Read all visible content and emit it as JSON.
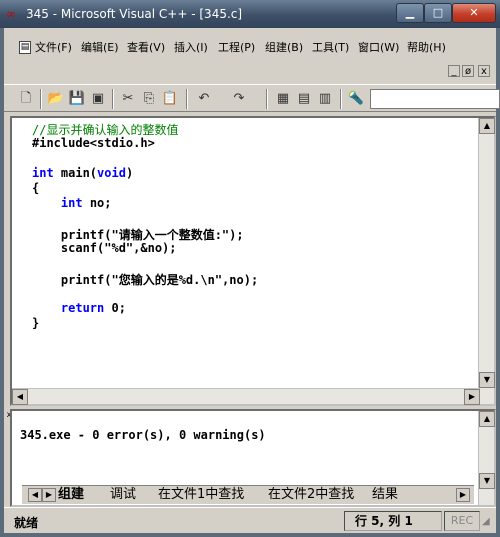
{
  "window": {
    "title": "345 - Microsoft Visual C++ - [345.c]",
    "min_glyph": "▁",
    "max_glyph": "□",
    "close_glyph": "✕"
  },
  "menu": {
    "items": [
      "文件(F)",
      "编辑(E)",
      "查看(V)",
      "插入(I)",
      "工程(P)",
      "组建(B)",
      "工具(T)",
      "窗口(W)",
      "帮助(H)"
    ],
    "mdi_min": "_",
    "mdi_restore": "ø",
    "mdi_close": "x"
  },
  "toolbar": {
    "icons": [
      "new-file-icon",
      "open-folder-icon",
      "save-icon",
      "save-all-icon",
      "cut-icon",
      "copy-icon",
      "paste-icon",
      "undo-icon",
      "redo-icon",
      "workspace-icon",
      "output-window-icon",
      "window-list-icon",
      "find-in-files-icon"
    ],
    "glyphs": [
      "🗋",
      "📂",
      "💾",
      "▣",
      "✂",
      "⎘",
      "📋",
      "↶",
      "↷",
      "▦",
      "▤",
      "▥",
      "🔦"
    ],
    "find_value": ""
  },
  "editor": {
    "lines": [
      {
        "text": "//显示并确认输入的整数值",
        "kind": "comment"
      },
      {
        "text": "#include<stdio.h>",
        "kind": "plain"
      },
      {
        "text": "",
        "kind": "plain"
      },
      {
        "text": "int main(void)",
        "kind": "mixed_int"
      },
      {
        "text": "{",
        "kind": "plain"
      },
      {
        "text": "    int no;",
        "kind": "mixed_int"
      },
      {
        "text": "",
        "kind": "plain"
      },
      {
        "text": "    printf(\"请输入一个整数值:\");",
        "kind": "plain"
      },
      {
        "text": "    scanf(\"%d\",&no);",
        "kind": "plain"
      },
      {
        "text": "",
        "kind": "plain"
      },
      {
        "text": "    printf(\"您输入的是%d.\\n\",no);",
        "kind": "plain"
      },
      {
        "text": "",
        "kind": "plain"
      },
      {
        "text": "    return 0;",
        "kind": "mixed_return"
      },
      {
        "text": "}",
        "kind": "plain"
      }
    ]
  },
  "output": {
    "text": "345.exe - 0 error(s), 0 warning(s)",
    "close_glyph": "x"
  },
  "tabs": [
    "组建",
    "调试",
    "在文件1中查找",
    "在文件2中查找",
    "结果"
  ],
  "status": {
    "ready": "就绪",
    "position": "行 5, 列 1",
    "rec": "REC"
  },
  "colors": {
    "comment": "#008000",
    "keyword": "#0000ff",
    "close_button": "#c4402a"
  }
}
